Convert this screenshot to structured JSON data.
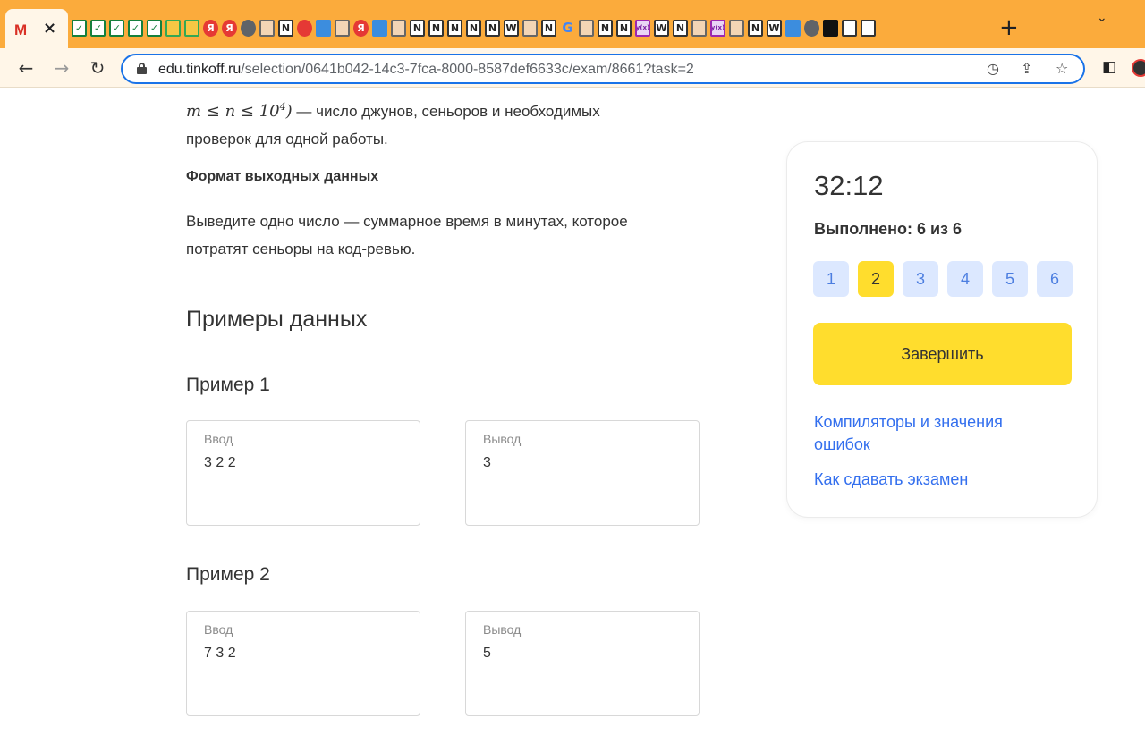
{
  "browser": {
    "url_host": "edu.tinkoff.ru",
    "url_path": "/selection/0641b042-14c3-7fca-8000-8587def6633c/exam/8661?task=2",
    "active_tab_icon": "gmail-icon",
    "favicons": [
      {
        "name": "check-icon",
        "glyph": "✓",
        "style": "green"
      },
      {
        "name": "check-icon",
        "glyph": "✓",
        "style": "green"
      },
      {
        "name": "check-icon",
        "glyph": "✓",
        "style": "green"
      },
      {
        "name": "check-icon",
        "glyph": "✓",
        "style": "green"
      },
      {
        "name": "check-icon",
        "glyph": "✓",
        "style": "green"
      },
      {
        "name": "drive-icon",
        "glyph": "",
        "style": "drive"
      },
      {
        "name": "drive-icon",
        "glyph": "",
        "style": "drive"
      },
      {
        "name": "yandex-icon",
        "glyph": "Я",
        "style": "red"
      },
      {
        "name": "yandex-icon",
        "glyph": "Я",
        "style": "red"
      },
      {
        "name": "globe-icon",
        "glyph": "",
        "style": "gray"
      },
      {
        "name": "avatar-icon",
        "glyph": "",
        "style": "person"
      },
      {
        "name": "notion-icon",
        "glyph": "N",
        "style": ""
      },
      {
        "name": "glove-icon",
        "glyph": "",
        "style": "red"
      },
      {
        "name": "image-icon",
        "glyph": "",
        "style": "blue"
      },
      {
        "name": "avatar-icon",
        "glyph": "",
        "style": "person"
      },
      {
        "name": "yandex-icon",
        "glyph": "Я",
        "style": "red"
      },
      {
        "name": "image-icon",
        "glyph": "",
        "style": "blue"
      },
      {
        "name": "avatar-icon",
        "glyph": "",
        "style": "person"
      },
      {
        "name": "notion-icon",
        "glyph": "N",
        "style": ""
      },
      {
        "name": "notion-icon",
        "glyph": "N",
        "style": ""
      },
      {
        "name": "notion-icon",
        "glyph": "N",
        "style": ""
      },
      {
        "name": "notion-icon",
        "glyph": "N",
        "style": ""
      },
      {
        "name": "notion-icon",
        "glyph": "N",
        "style": ""
      },
      {
        "name": "wikipedia-icon",
        "glyph": "W",
        "style": ""
      },
      {
        "name": "avatar-icon",
        "glyph": "",
        "style": "person"
      },
      {
        "name": "notion-icon",
        "glyph": "N",
        "style": ""
      },
      {
        "name": "google-icon",
        "glyph": "G",
        "style": "google"
      },
      {
        "name": "avatar-icon",
        "glyph": "",
        "style": "person"
      },
      {
        "name": "notion-icon",
        "glyph": "N",
        "style": ""
      },
      {
        "name": "notion-icon",
        "glyph": "N",
        "style": ""
      },
      {
        "name": "formula-icon",
        "glyph": "y(x)",
        "style": "purple"
      },
      {
        "name": "wikipedia-icon",
        "glyph": "W",
        "style": ""
      },
      {
        "name": "notion-icon",
        "glyph": "N",
        "style": ""
      },
      {
        "name": "avatar-icon",
        "glyph": "",
        "style": "person"
      },
      {
        "name": "formula-icon",
        "glyph": "y(x)",
        "style": "purple"
      },
      {
        "name": "avatar-icon",
        "glyph": "",
        "style": "person"
      },
      {
        "name": "notion-icon",
        "glyph": "N",
        "style": ""
      },
      {
        "name": "wikipedia-icon",
        "glyph": "W",
        "style": ""
      },
      {
        "name": "image-icon",
        "glyph": "",
        "style": "blue"
      },
      {
        "name": "globe-icon",
        "glyph": "",
        "style": "gray"
      },
      {
        "name": "square-icon",
        "glyph": "",
        "style": "black"
      },
      {
        "name": "square-icon",
        "glyph": "",
        "style": ""
      },
      {
        "name": "stackoverflow-icon",
        "glyph": "",
        "style": ""
      }
    ],
    "colors": {
      "tab_strip": "#fbab3c",
      "toolbar": "#fff6e8",
      "omnibox_border": "#1a73e8"
    }
  },
  "problem": {
    "constraint_tail": "— число джунов, сеньоров и необходимых",
    "constraint_line2": "проверок для одной работы.",
    "output_format_heading": "Формат выходных данных",
    "output_line1": "Выведите одно число — суммарное время в минутах, которое",
    "output_line2": "потратят сеньоры на код-ревью.",
    "examples_heading": "Примеры данных",
    "examples": [
      {
        "title": "Пример 1",
        "input_label": "Ввод",
        "input": "3 2 2",
        "output_label": "Вывод",
        "output": "3"
      },
      {
        "title": "Пример 2",
        "input_label": "Ввод",
        "input": "7 3 2",
        "output_label": "Вывод",
        "output": "5"
      }
    ]
  },
  "sidebar": {
    "timer": "32:12",
    "progress": "Выполнено: 6 из 6",
    "tasks": [
      "1",
      "2",
      "3",
      "4",
      "5",
      "6"
    ],
    "active_task": "2",
    "finish_label": "Завершить",
    "link_compilers": "Компиляторы и значения ошибок",
    "link_howto": "Как сдавать экзамен",
    "colors": {
      "accent_yellow": "#ffdd2d",
      "task_chip": "#dce8ff",
      "link": "#336fee"
    }
  }
}
